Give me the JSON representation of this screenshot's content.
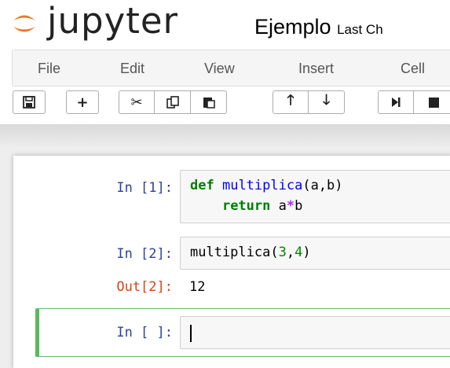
{
  "header": {
    "logo_text": "jupyter",
    "notebook_name": "Ejemplo",
    "checkpoint_text": "Last Ch"
  },
  "menubar": {
    "items": [
      "File",
      "Edit",
      "View",
      "Insert",
      "Cell"
    ]
  },
  "toolbar": {
    "buttons": [
      {
        "name": "save-icon",
        "glyph": "🖫"
      },
      {
        "name": "plus-icon",
        "glyph": "+"
      },
      {
        "name": "scissors-icon",
        "glyph": "✂"
      },
      {
        "name": "copy-icon",
        "glyph": "⎘"
      },
      {
        "name": "paste-icon",
        "glyph": "📋"
      },
      {
        "name": "arrow-up-icon",
        "glyph": "↑"
      },
      {
        "name": "arrow-down-icon",
        "glyph": "↓"
      },
      {
        "name": "step-forward-icon",
        "glyph": "⏭"
      },
      {
        "name": "stop-icon",
        "glyph": "■"
      }
    ]
  },
  "cells": [
    {
      "prompt": "In [1]:",
      "line1_kw": "def",
      "line1_fn": "multiplica",
      "line1_rest": "(a,b)",
      "line2_kw": "return",
      "line2_a": " a",
      "line2_op": "*",
      "line2_b": "b"
    },
    {
      "prompt": "In [2]:",
      "code_fn": "multiplica",
      "code_open": "(",
      "code_n1": "3",
      "code_comma": ",",
      "code_n2": "4",
      "code_close": ")",
      "out_prompt": "Out[2]:",
      "output": "12"
    },
    {
      "prompt": "In [ ]:"
    }
  ],
  "colors": {
    "in_prompt": "#303f9f",
    "out_prompt": "#d84315",
    "keyword": "#008000",
    "selected_cell_border": "#5cb85c"
  }
}
